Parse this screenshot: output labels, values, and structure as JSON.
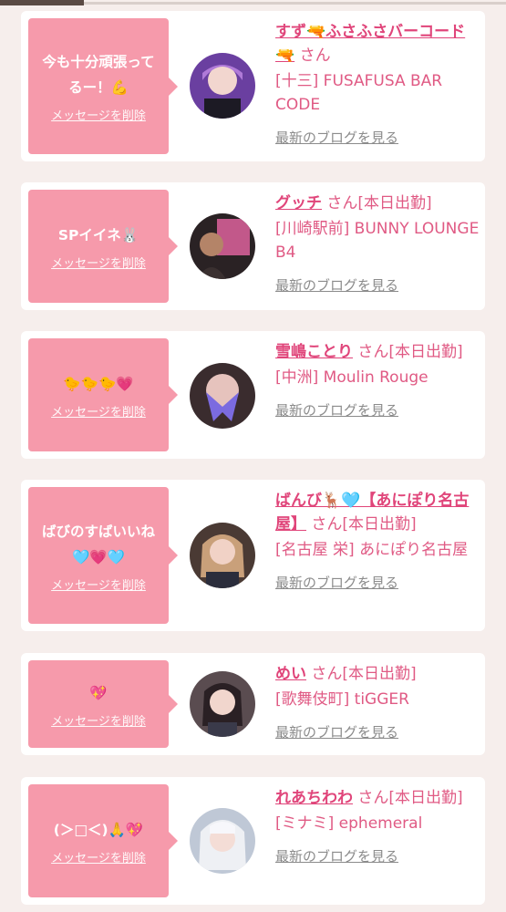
{
  "cards": [
    {
      "message": "今も十分頑張ってるー！💪",
      "delete_label": "メッセージを削除",
      "name": "すず🔫ふさふさバーコード🔫",
      "san": "さん",
      "status": "",
      "shop": "[十三] FUSAFUSA BAR CODE",
      "blog_link": "最新のブログを見る"
    },
    {
      "message": "SPイイネ🐰",
      "delete_label": "メッセージを削除",
      "name": "グッチ",
      "san": "さん",
      "status": "[本日出勤]",
      "shop": "[川崎駅前] BUNNY LOUNGE B4",
      "blog_link": "最新のブログを見る"
    },
    {
      "message": "🐤🐤🐤💗",
      "delete_label": "メッセージを削除",
      "name": "雪嶋ことり",
      "san": "さん",
      "status": "[本日出勤]",
      "shop": "[中洲] Moulin Rouge",
      "blog_link": "最新のブログを見る"
    },
    {
      "message": "ばびのすばいいね🩵💗🩵",
      "delete_label": "メッセージを削除",
      "name": "ばんび🦌🩵【あにぽり名古屋】",
      "san": "さん",
      "status": "[本日出勤]",
      "shop": "[名古屋 栄] あにぽり名古屋",
      "blog_link": "最新のブログを見る"
    },
    {
      "message": "💖",
      "delete_label": "メッセージを削除",
      "name": "めい",
      "san": "さん",
      "status": "[本日出勤]",
      "shop": "[歌舞伎町] tiGGER",
      "blog_link": "最新のブログを見る"
    },
    {
      "message": "(＞□＜)🙏💖",
      "delete_label": "メッセージを削除",
      "name": "れあちわわ",
      "san": "さん",
      "status": "[本日出勤]",
      "shop": "[ミナミ] ephemeral",
      "blog_link": "最新のブログを見る"
    }
  ],
  "colors": {
    "background": "#f6eeec",
    "bubble": "#f69aab",
    "name": "#e0457a",
    "link_gray": "#8b8b8b"
  }
}
